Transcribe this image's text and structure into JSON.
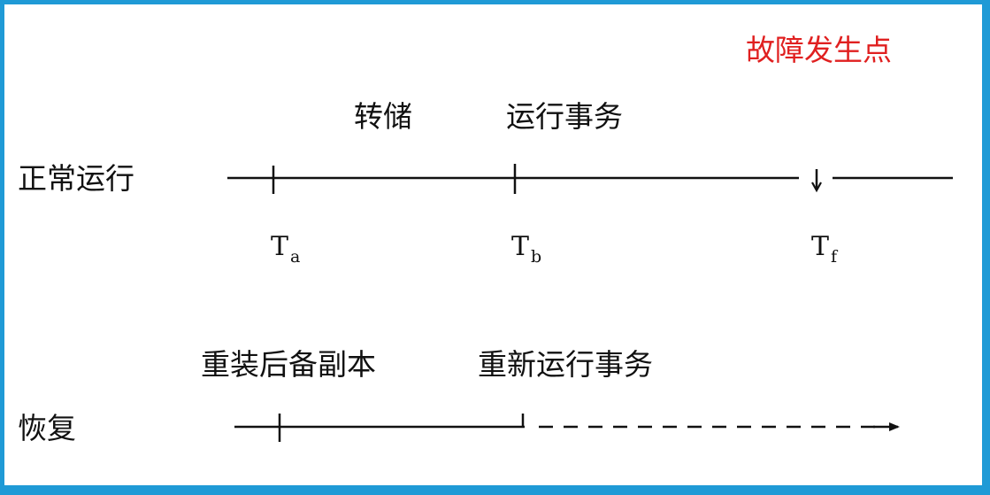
{
  "labels": {
    "failure_point": "故障发生点",
    "dump": "转储",
    "run_transactions": "运行事务",
    "normal_run": "正常运行",
    "reload_backup": "重装后备副本",
    "rerun_transactions": "重新运行事务",
    "recovery": "恢复"
  },
  "time_points": {
    "a": {
      "main": "T",
      "sub": "a"
    },
    "b": {
      "main": "T",
      "sub": "b"
    },
    "f": {
      "main": "T",
      "sub": "f"
    }
  },
  "colors": {
    "border": "#1f9ad6",
    "highlight": "#e02020",
    "ink": "#111111"
  }
}
